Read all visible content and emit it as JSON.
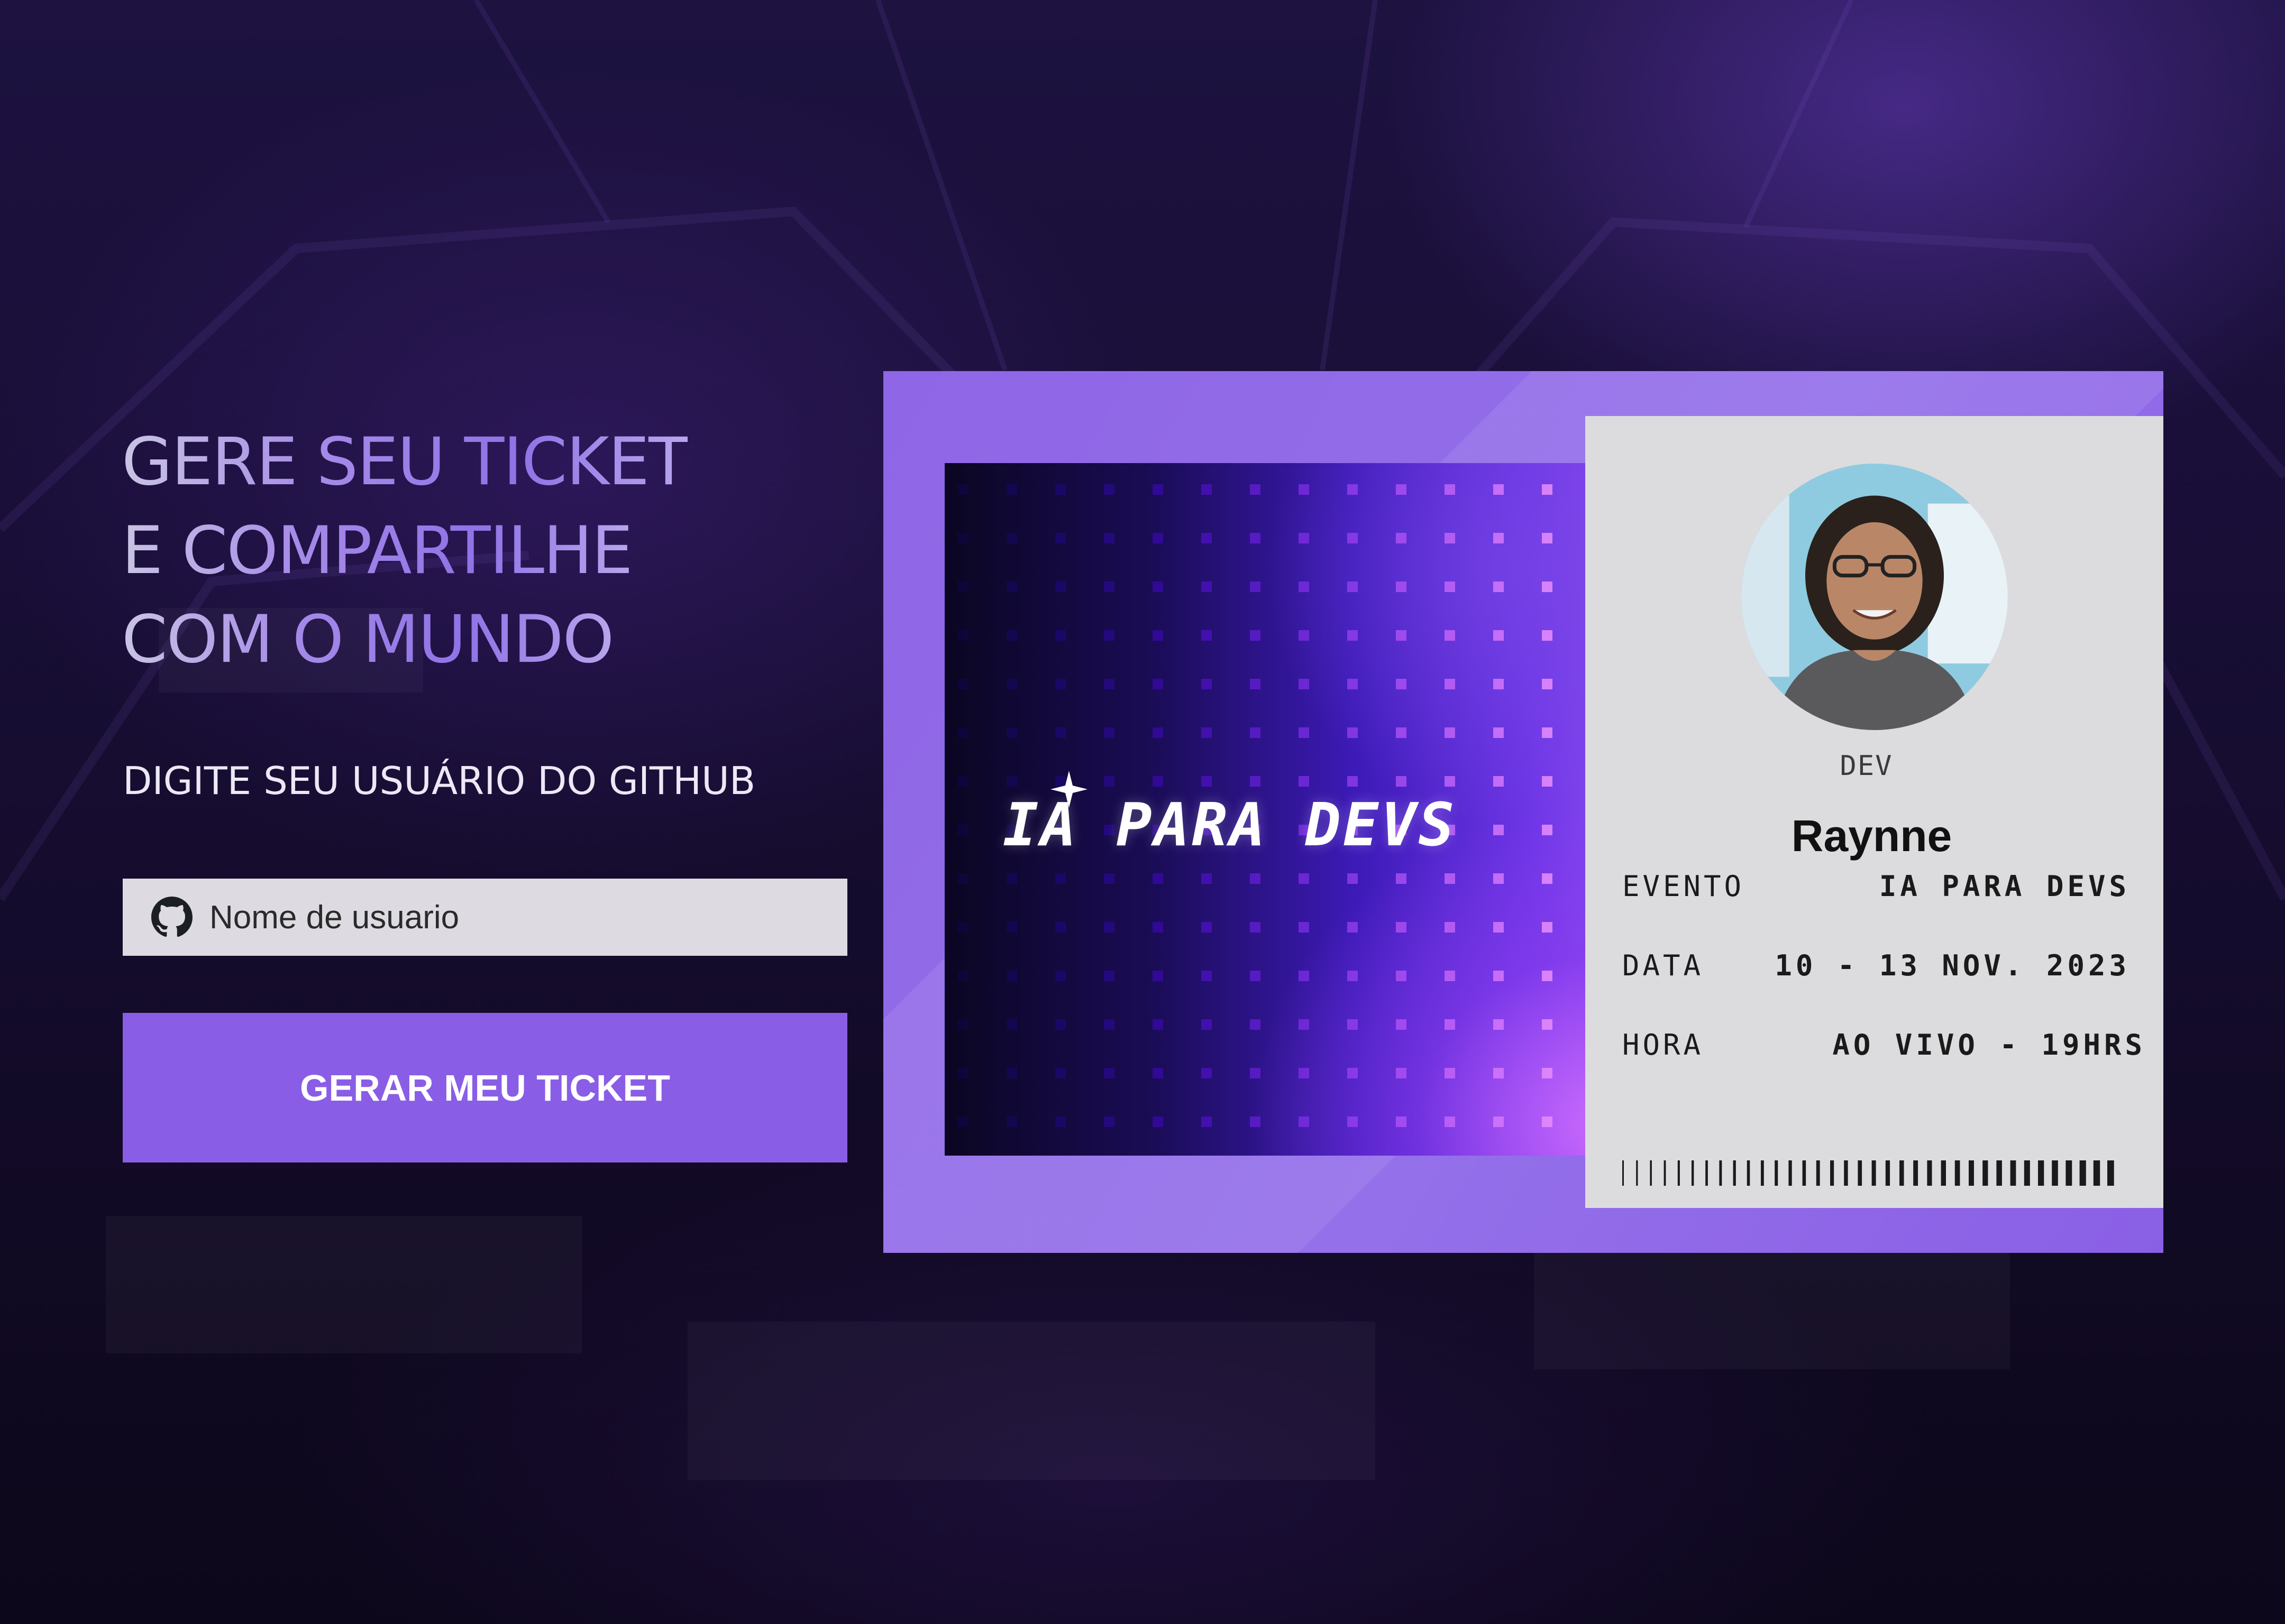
{
  "headline": {
    "line1": "GERE SEU TICKET",
    "line2": "E COMPARTILHE",
    "line3": "COM O MUNDO"
  },
  "form": {
    "subtitle": "DIGITE SEU USUÁRIO DO GITHUB",
    "input_placeholder": "Nome de usuario",
    "input_value": "",
    "submit_label": "GERAR MEU TICKET"
  },
  "ticket": {
    "banner_logo": "IA PARA DEVS",
    "role": "DEV",
    "name": "Raynne",
    "rows": [
      {
        "label": "EVENTO",
        "value": "IA PARA DEVS"
      },
      {
        "label": "DATA",
        "value": "10 - 13 NOV. 2023"
      },
      {
        "label": "HORA",
        "value": "AO VIVO - 19HRS"
      }
    ]
  },
  "colors": {
    "accent": "#8a5de6",
    "ticket_frame": "#9470ea",
    "card_bg": "#dcdcde",
    "page_bg": "#150c2e"
  },
  "icons": [
    "github-icon",
    "sparkle-icon"
  ]
}
